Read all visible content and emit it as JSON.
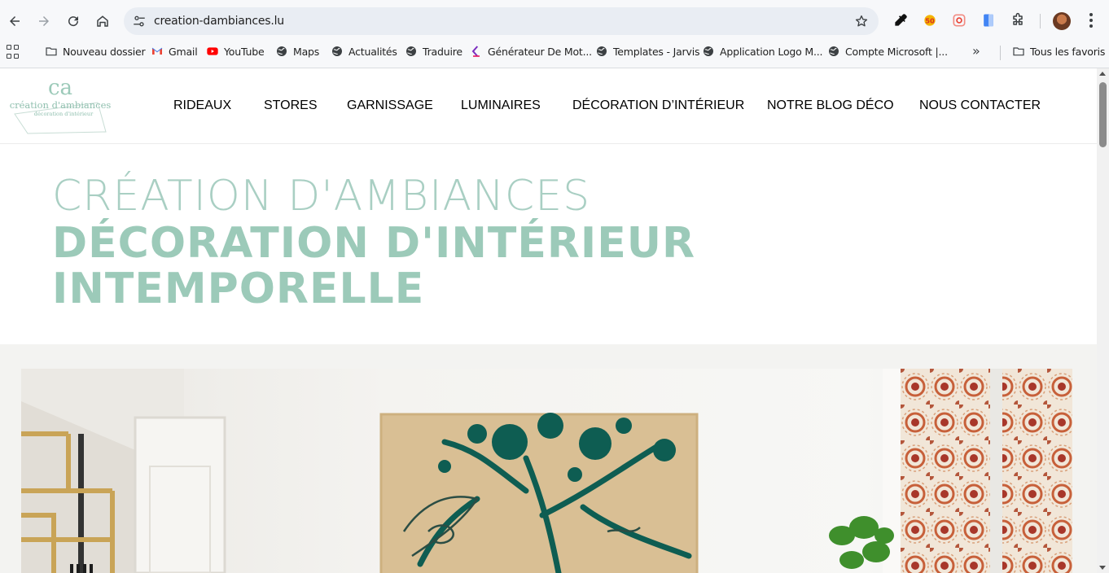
{
  "browser": {
    "url": "creation-dambiances.lu",
    "bookmarks": [
      {
        "label": "Nouveau dossier",
        "icon": "folder-icon"
      },
      {
        "label": "Gmail",
        "icon": "gmail-icon"
      },
      {
        "label": "YouTube",
        "icon": "youtube-icon"
      },
      {
        "label": "Maps",
        "icon": "globe-icon"
      },
      {
        "label": "Actualités",
        "icon": "globe-icon"
      },
      {
        "label": "Traduire",
        "icon": "globe-icon"
      },
      {
        "label": "Générateur De Mot...",
        "icon": "k-logo-icon"
      },
      {
        "label": "Templates - Jarvis",
        "icon": "globe-icon"
      },
      {
        "label": "Application Logo M...",
        "icon": "globe-icon"
      },
      {
        "label": "Compte Microsoft |...",
        "icon": "globe-icon"
      }
    ],
    "all_bookmarks_label": "Tous les favoris",
    "more_bookmarks_label": "»"
  },
  "site": {
    "logo": {
      "monogram": "ca",
      "name": "création d'ambiances",
      "tagline": "décoration d'intérieur"
    },
    "menu": [
      "RIDEAUX",
      "STORES",
      "GARNISSAGE",
      "LUMINAIRES",
      "DÉCORATION D’INTÉRIEUR",
      "NOTRE BLOG DÉCO",
      "NOUS CONTACTER"
    ],
    "hero": {
      "line1": "CRÉATION D'AMBIANCES",
      "line2": "DÉCORATION D'INTÉRIEUR",
      "line3": "INTEMPORELLE"
    }
  },
  "colors": {
    "accent": "#9ccab9",
    "accent_light": "#a9cfc3",
    "menu_text": "#3a3a3a",
    "page_bg": "#f3f3f1"
  }
}
